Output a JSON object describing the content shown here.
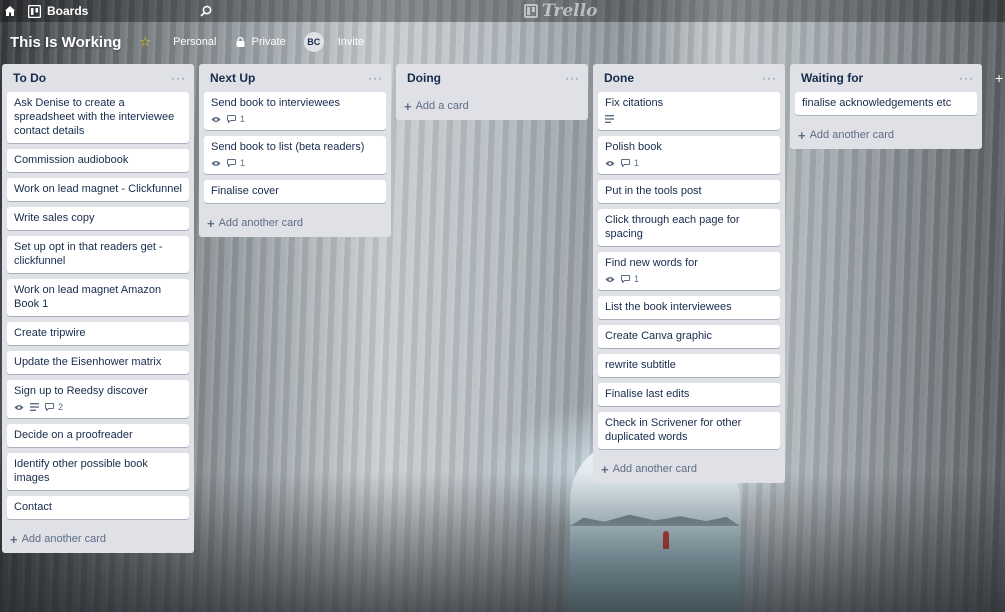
{
  "header": {
    "boards_label": "Boards",
    "logo_text": "Trello"
  },
  "board": {
    "title": "This Is Working",
    "visibility_team": "Personal",
    "visibility_privacy": "Private",
    "member_initials": "BC",
    "invite_label": "Invite"
  },
  "lists": [
    {
      "title": "To Do",
      "add_label": "Add another card",
      "cards": [
        {
          "text": "Ask Denise to create a spreadsheet with the interviewee contact details"
        },
        {
          "text": "Commission audiobook"
        },
        {
          "text": "Work on lead magnet - Clickfunnel"
        },
        {
          "text": "Write sales copy"
        },
        {
          "text": "Set up opt in that readers get - clickfunnel"
        },
        {
          "text": "Work on lead magnet Amazon Book 1"
        },
        {
          "text": "Create tripwire"
        },
        {
          "text": "Update the Eisenhower matrix"
        },
        {
          "text": "Sign up to Reedsy discover",
          "comments": "2"
        },
        {
          "text": "Decide on a proofreader"
        },
        {
          "text": "Identify other possible book images"
        },
        {
          "text": "Contact"
        }
      ]
    },
    {
      "title": "Next Up",
      "add_label": "Add another card",
      "cards": [
        {
          "text": "Send book to interviewees",
          "comments": "1"
        },
        {
          "text": "Send book to list (beta readers)",
          "comments": "1"
        },
        {
          "text": "Finalise cover"
        }
      ]
    },
    {
      "title": "Doing",
      "add_label": "Add a card",
      "cards": []
    },
    {
      "title": "Done",
      "add_label": "Add another card",
      "cards": [
        {
          "text": "Fix citations"
        },
        {
          "text": "Polish book",
          "comments": "1"
        },
        {
          "text": "Put in the tools post"
        },
        {
          "text": "Click through each page for spacing"
        },
        {
          "text": "Find new words for",
          "comments": "1"
        },
        {
          "text": "List the book interviewees"
        },
        {
          "text": "Create Canva graphic"
        },
        {
          "text": "rewrite subtitle"
        },
        {
          "text": "Finalise last edits"
        },
        {
          "text": "Check in Scrivener for other duplicated words"
        }
      ]
    },
    {
      "title": "Waiting for",
      "add_label": "Add another card",
      "cards": [
        {
          "text": "finalise acknowledgements etc"
        }
      ]
    }
  ]
}
